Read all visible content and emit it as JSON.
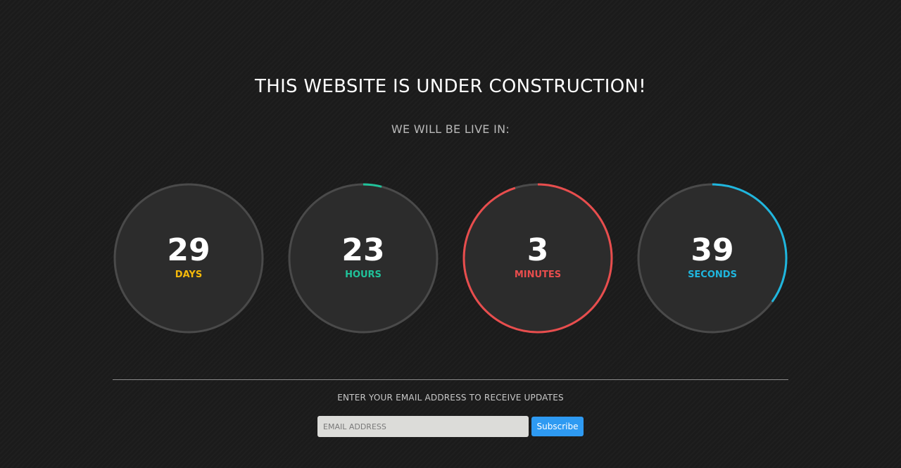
{
  "header": {
    "title": "THIS WEBSITE IS UNDER CONSTRUCTION!",
    "subtitle": "WE WILL BE LIVE IN:"
  },
  "countdown": [
    {
      "value": "29",
      "label": "DAYS",
      "color": "#f5b90a",
      "progress": 0.0
    },
    {
      "value": "23",
      "label": "HOURS",
      "color": "#20c29a",
      "progress": 0.04
    },
    {
      "value": "3",
      "label": "MINUTES",
      "color": "#e84d4d",
      "progress": 0.95
    },
    {
      "value": "39",
      "label": "SECONDS",
      "color": "#1fb6de",
      "progress": 0.35
    }
  ],
  "signup": {
    "prompt": "ENTER YOUR EMAIL ADDRESS TO RECEIVE UPDATES",
    "email_placeholder": "EMAIL ADDRESS",
    "email_value": "",
    "button_label": "Subscribe"
  },
  "colors": {
    "ring_track": "#4a4a4a",
    "circle_fill": "#2c2c2c",
    "button": "#2e9af2"
  }
}
